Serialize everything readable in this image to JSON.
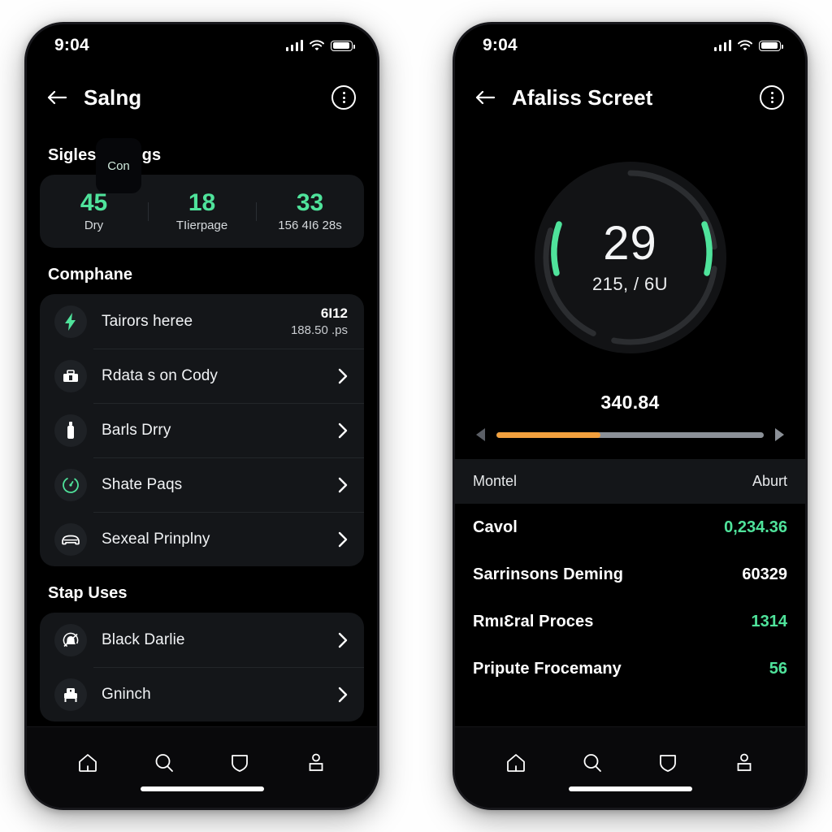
{
  "status_bar": {
    "time": "9:04",
    "signal_icon": "cellular-signal-icon",
    "wifi_icon": "wifi-icon",
    "battery_icon": "battery-icon"
  },
  "left_phone": {
    "app_bar": {
      "back_icon": "back-arrow-icon",
      "title": "Salng",
      "more_icon": "more-options-icon"
    },
    "ratings_section": {
      "title": "Sigles Ratings",
      "chip_label": "Con",
      "stats": [
        {
          "value": "45",
          "label": "Dry"
        },
        {
          "value": "18",
          "label": "TIierpage"
        },
        {
          "value": "33",
          "label": "156 4I6 28s"
        }
      ]
    },
    "compliance_section": {
      "title": "Comphane",
      "rows": [
        {
          "icon": "lightning-bolt-icon",
          "label": "Tairors heree",
          "primary_value": "6I12",
          "secondary_value": "188.50 .ps",
          "has_chevron": false
        },
        {
          "icon": "toolbox-icon",
          "label": "Rdata s on Cody",
          "has_chevron": true
        },
        {
          "icon": "bottle-icon",
          "label": "Barls Drry",
          "has_chevron": true
        },
        {
          "icon": "gauge-icon",
          "label": "Shate Paqs",
          "has_chevron": true
        },
        {
          "icon": "car-icon",
          "label": "Sexeal Prinplny",
          "has_chevron": true
        }
      ]
    },
    "usage_section": {
      "title": "Stap Uses",
      "rows": [
        {
          "icon": "bell-off-icon",
          "label": "Black Darlie",
          "has_chevron": true
        },
        {
          "icon": "printer-icon",
          "label": "Gninch",
          "has_chevron": true
        }
      ]
    }
  },
  "right_phone": {
    "app_bar": {
      "back_icon": "back-arrow-icon",
      "title": "Afaliss Screet",
      "more_icon": "more-options-icon"
    },
    "gauge": {
      "value": "29",
      "sub_value": "215, / 6U",
      "arc_color": "#4fe39b",
      "track_color": "#2b2d30"
    },
    "slider": {
      "value": "340.84",
      "fill_percent": 39,
      "fill_color": "#f2a03d",
      "track_color": "#8b9097",
      "left_arrow_icon": "arrow-left-icon",
      "right_arrow_icon": "arrow-right-icon"
    },
    "table": {
      "columns": [
        "Montel",
        "Aburt"
      ],
      "rows": [
        {
          "name": "Cavol",
          "value": "0,234.36",
          "value_color": "green"
        },
        {
          "name": "Sarrinsons Deming",
          "value": "60329",
          "value_color": "white"
        },
        {
          "name": "RmıƐral Proces",
          "value": "1314",
          "value_color": "green"
        },
        {
          "name": "Pripute Frocemany",
          "value": "56",
          "value_color": "green"
        }
      ]
    }
  },
  "bottom_nav": {
    "items": [
      {
        "icon": "home-icon"
      },
      {
        "icon": "search-icon"
      },
      {
        "icon": "shield-icon"
      },
      {
        "icon": "profile-icon"
      }
    ]
  }
}
